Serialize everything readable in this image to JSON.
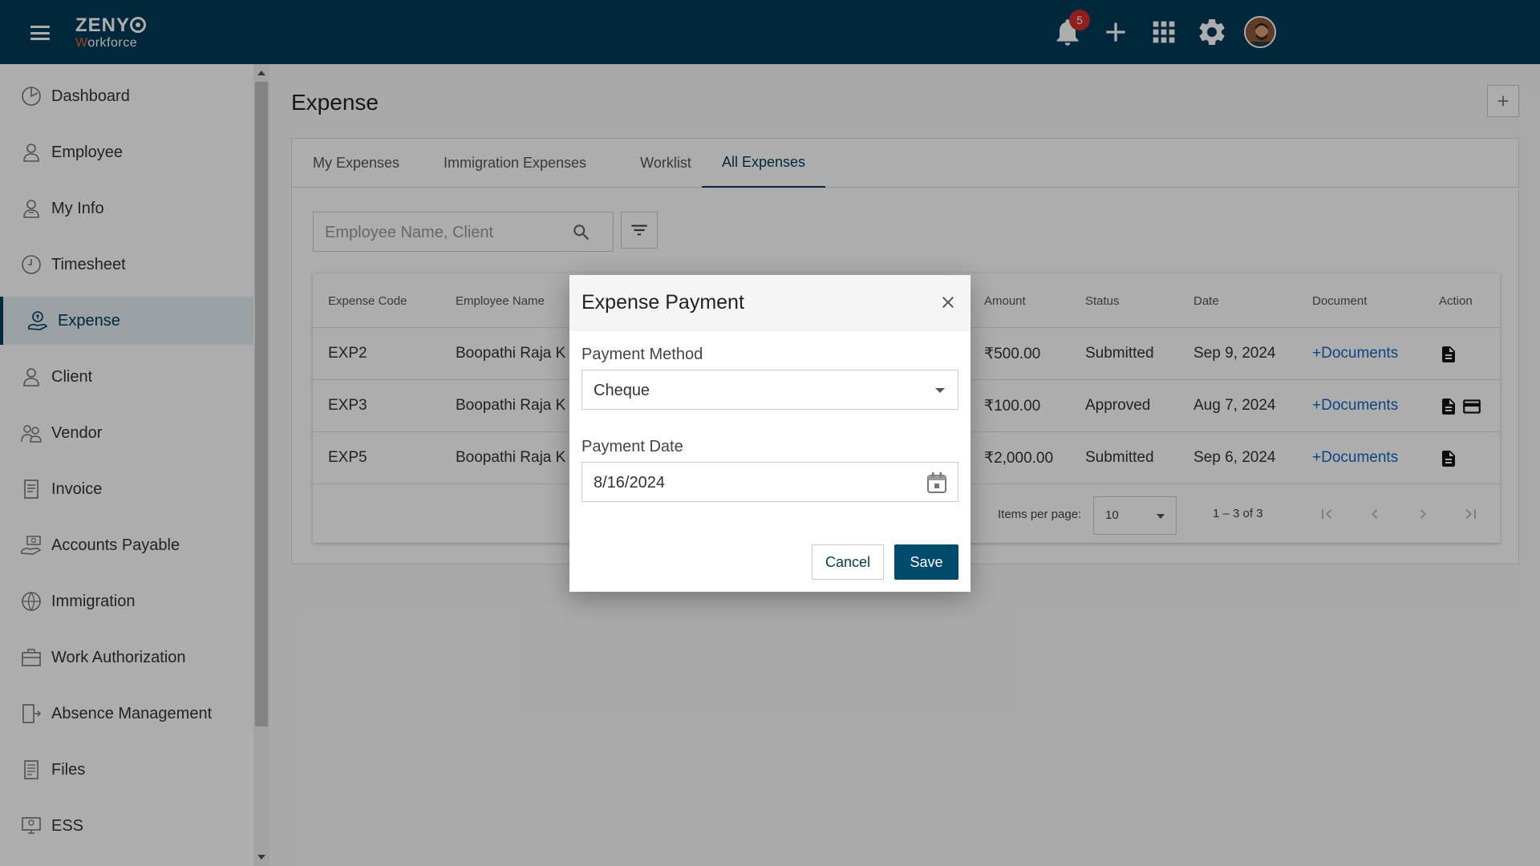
{
  "header": {
    "logo_top": "ZENY",
    "logo_bottom_w": "W",
    "logo_bottom_rest": "orkforce",
    "notification_count": "5",
    "brand_color": "#003a57",
    "accent_color": "#e8602c"
  },
  "sidebar": {
    "items": [
      {
        "label": "Dashboard",
        "icon": "dashboard-icon"
      },
      {
        "label": "Employee",
        "icon": "employee-icon"
      },
      {
        "label": "My Info",
        "icon": "my-info-icon"
      },
      {
        "label": "Timesheet",
        "icon": "clock-icon"
      },
      {
        "label": "Expense",
        "icon": "expense-icon",
        "active": true
      },
      {
        "label": "Client",
        "icon": "client-icon"
      },
      {
        "label": "Vendor",
        "icon": "vendor-icon"
      },
      {
        "label": "Invoice",
        "icon": "invoice-icon"
      },
      {
        "label": "Accounts Payable",
        "icon": "accounts-payable-icon"
      },
      {
        "label": "Immigration",
        "icon": "immigration-icon"
      },
      {
        "label": "Work Authorization",
        "icon": "work-authorization-icon"
      },
      {
        "label": "Absence Management",
        "icon": "absence-icon"
      },
      {
        "label": "Files",
        "icon": "files-icon"
      },
      {
        "label": "ESS",
        "icon": "ess-icon"
      }
    ]
  },
  "main": {
    "title": "Expense",
    "tabs": [
      {
        "label": "My Expenses"
      },
      {
        "label": "Immigration Expenses"
      },
      {
        "label": "Worklist"
      },
      {
        "label": "All Expenses",
        "active": true
      }
    ],
    "search_placeholder": "Employee Name, Client",
    "table": {
      "headers": [
        "Expense Code",
        "Employee Name",
        "Amount",
        "Status",
        "Date",
        "Document",
        "Action"
      ],
      "rows": [
        {
          "code": "EXP2",
          "name": "Boopathi Raja K",
          "amount": "₹500.00",
          "status": "Submitted",
          "date": "Sep 9, 2024",
          "document": "+Documents"
        },
        {
          "code": "EXP3",
          "name": "Boopathi Raja K",
          "amount": "₹100.00",
          "status": "Approved",
          "date": "Aug 7, 2024",
          "document": "+Documents"
        },
        {
          "code": "EXP5",
          "name": "Boopathi Raja K",
          "amount": "₹2,000.00",
          "status": "Submitted",
          "date": "Sep 6, 2024",
          "document": "+Documents"
        }
      ]
    },
    "pager": {
      "items_per_page_label": "Items per page:",
      "items_per_page": "10",
      "range": "1 – 3 of 3"
    }
  },
  "dialog": {
    "title": "Expense Payment",
    "payment_method_label": "Payment Method",
    "payment_method": "Cheque",
    "payment_date_label": "Payment Date",
    "payment_date": "8/16/2024",
    "cancel_label": "Cancel",
    "save_label": "Save"
  }
}
